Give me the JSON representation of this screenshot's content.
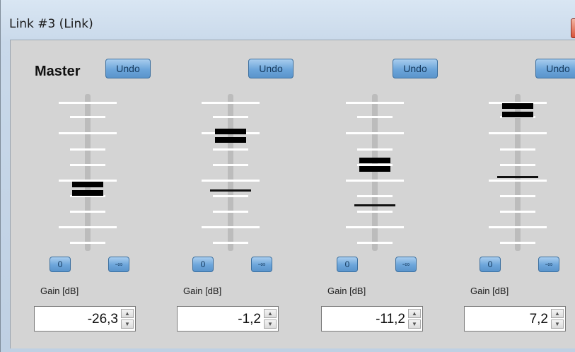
{
  "window": {
    "title": "Link #3 (Link)"
  },
  "master": {
    "label": "Master"
  },
  "channels": [
    {
      "undo_label": "Undo",
      "zero_label": "0",
      "min_label": "-∞",
      "gain_label": "Gain [dB]",
      "gain_value": "-26,3"
    },
    {
      "undo_label": "Undo",
      "zero_label": "0",
      "min_label": "-∞",
      "gain_label": "Gain [dB]",
      "gain_value": "-1,2"
    },
    {
      "undo_label": "Undo",
      "zero_label": "0",
      "min_label": "-∞",
      "gain_label": "Gain [dB]",
      "gain_value": "-11,2"
    },
    {
      "undo_label": "Undo",
      "zero_label": "0",
      "min_label": "-∞",
      "gain_label": "Gain [dB]",
      "gain_value": "7,2"
    }
  ],
  "icons": {
    "up_arrow": "▲",
    "down_arrow": "▼"
  }
}
